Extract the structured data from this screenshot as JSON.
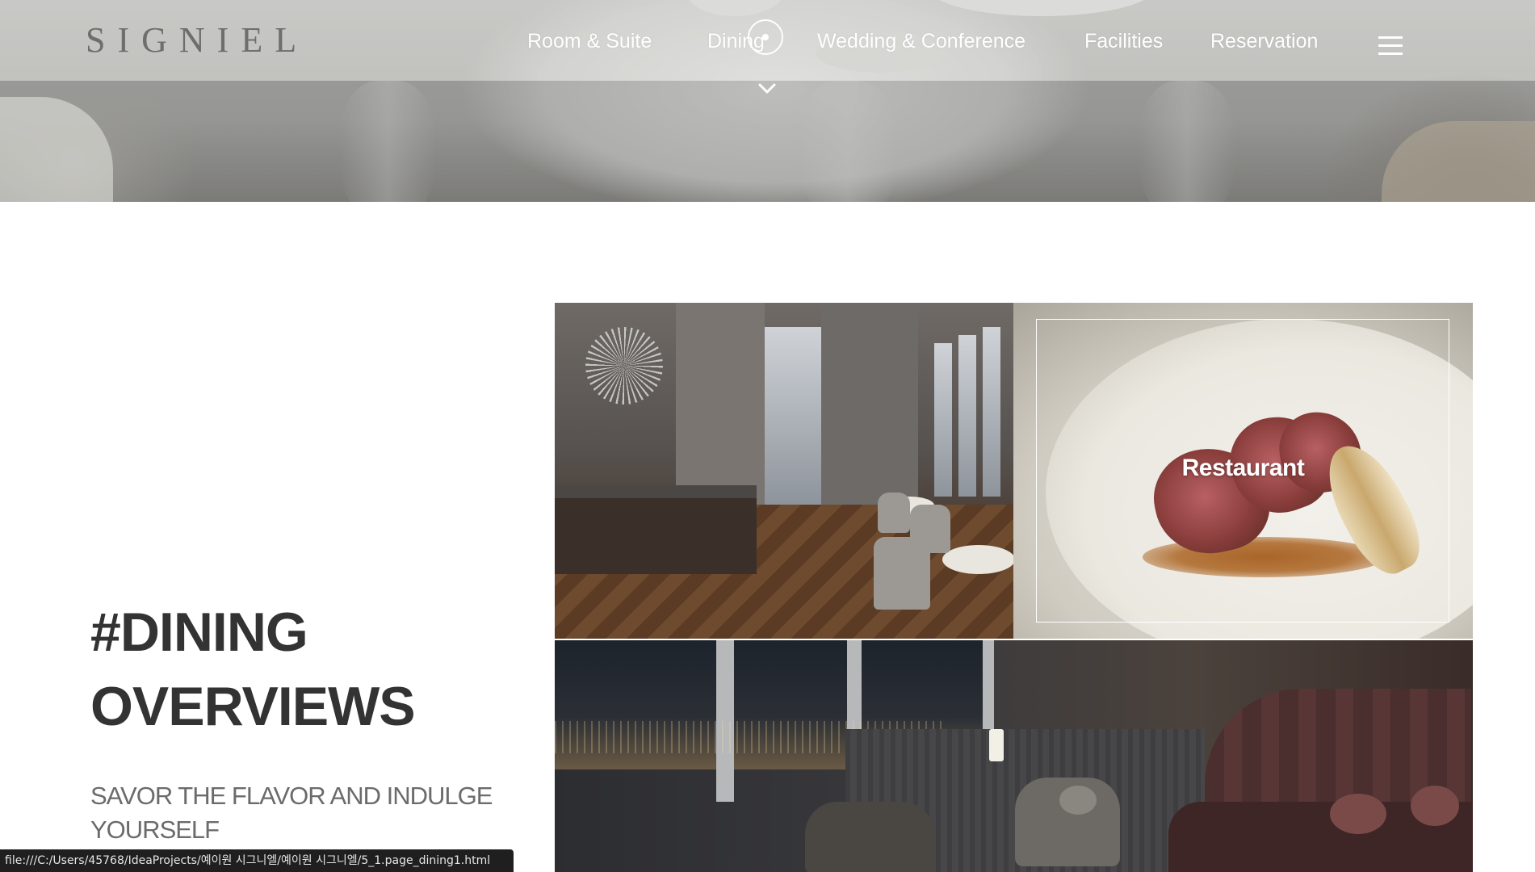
{
  "header": {
    "logo": "SIGNIEL",
    "nav": [
      {
        "label": "Room & Suite"
      },
      {
        "label": "Dining"
      },
      {
        "label": "Wedding & Conference"
      },
      {
        "label": "Facilities"
      },
      {
        "label": "Reservation"
      }
    ],
    "menu_icon": "hamburger-icon",
    "scroll_icon": "chevron-down-icon"
  },
  "main": {
    "title_line1": "#DINING",
    "title_line2": "OVERVIEWS",
    "subtitle": "SAVOR THE FLAVOR AND INDULGE YOURSELF",
    "gallery": {
      "restaurant_label": "Restaurant"
    }
  },
  "status_bar": {
    "url": "file:///C:/Users/45768/IdeaProjects/예이원 시그니엘/예이원 시그니엘/5_1.page_dining1.html"
  },
  "colors": {
    "title": "#333333",
    "subtitle": "#6b6b6b",
    "nav_text": "#ffffff",
    "logo": "#6e6e6c"
  }
}
